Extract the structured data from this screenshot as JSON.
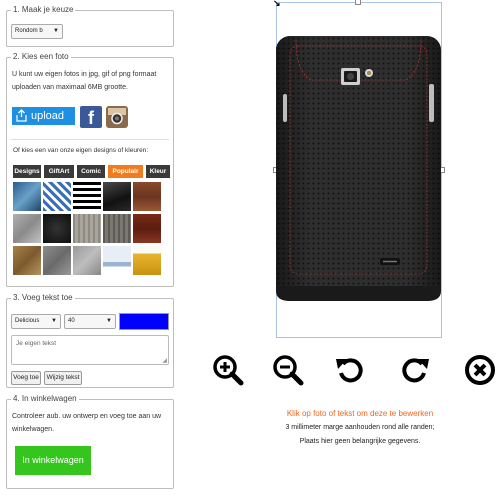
{
  "panel1": {
    "legend": "1. Maak je keuze",
    "select_value": "Rondom b"
  },
  "panel2": {
    "legend": "2. Kies een foto",
    "description": "U kunt uw eigen fotos in jpg, gif of png formaat uploaden van maximaal 6MB grootte.",
    "upload_label": "upload",
    "designs_text": "Of kies een van onze eigen designs of kleuren:",
    "tabs": [
      "Designs",
      "GiftArt",
      "Comic",
      "Populair",
      "Kleur"
    ],
    "active_tab": "Populair"
  },
  "panel3": {
    "legend": "3. Voeg tekst toe",
    "font_value": "Delicious",
    "size_value": "40",
    "text_color": "#0000ff",
    "textarea_placeholder": "Je eigen tekst",
    "add_label": "Voeg toe",
    "edit_label": "Wijzig tekst"
  },
  "panel4": {
    "legend": "4. In winkelwagen",
    "description": "Controleer aub. uw ontwerp en voeg toe aan uw winkelwagen.",
    "cart_label": "In winkelwagen",
    "cart_color": "#35c61e"
  },
  "editor": {
    "instruction": "Klik op foto of tekst om deze te bewerken",
    "margin_note": "3 millimeter marge aanhouden rond alle randen;",
    "warning": "Plaats hier geen belangrijke gegevens.",
    "accent": "#f0651e"
  }
}
